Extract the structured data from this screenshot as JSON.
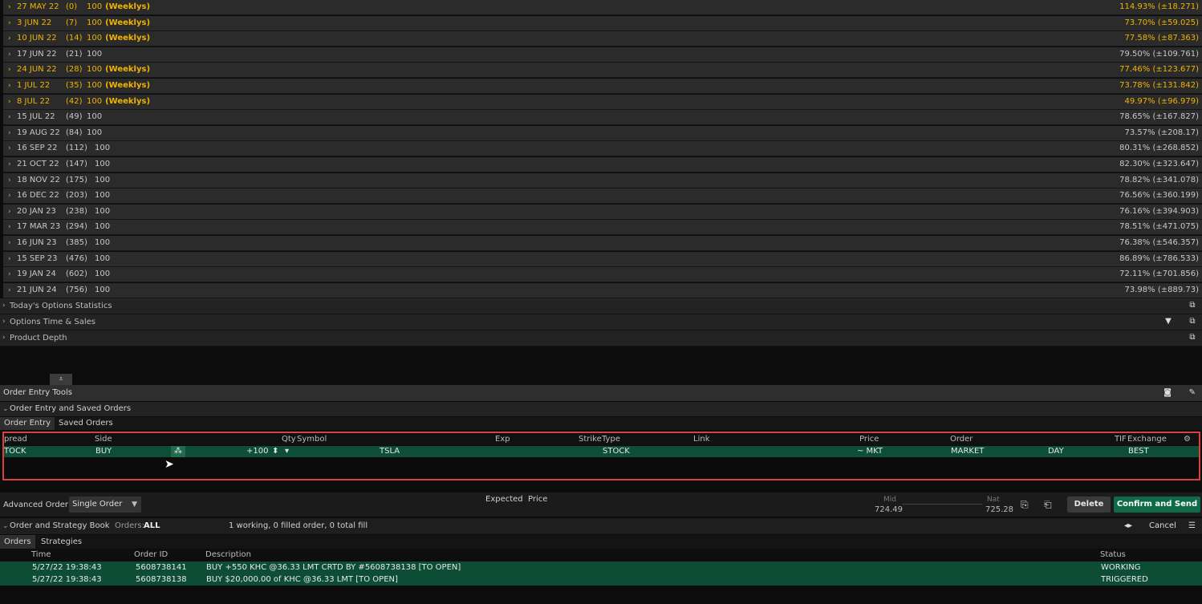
{
  "chain": {
    "rows": [
      {
        "date": "27 MAY 22",
        "days": "(0)",
        "mult": "100",
        "weekly": "(Weeklys)",
        "iv": "114.93% (±18.271)"
      },
      {
        "date": "3 JUN 22",
        "days": "(7)",
        "mult": "100",
        "weekly": "(Weeklys)",
        "iv": "73.70% (±59.025)"
      },
      {
        "date": "10 JUN 22",
        "days": "(14)",
        "mult": "100",
        "weekly": "(Weeklys)",
        "iv": "77.58% (±87.363)"
      },
      {
        "date": "17 JUN 22",
        "days": "(21)",
        "mult": "100",
        "weekly": "",
        "iv": "79.50% (±109.761)"
      },
      {
        "date": "24 JUN 22",
        "days": "(28)",
        "mult": "100",
        "weekly": "(Weeklys)",
        "iv": "77.46% (±123.677)"
      },
      {
        "date": "1 JUL 22",
        "days": "(35)",
        "mult": "100",
        "weekly": "(Weeklys)",
        "iv": "73.78% (±131.842)"
      },
      {
        "date": "8 JUL 22",
        "days": "(42)",
        "mult": "100",
        "weekly": "(Weeklys)",
        "iv": "49.97% (±96.979)"
      },
      {
        "date": "15 JUL 22",
        "days": "(49)",
        "mult": "100",
        "weekly": "",
        "iv": "78.65% (±167.827)"
      },
      {
        "date": "19 AUG 22",
        "days": "(84)",
        "mult": "100",
        "weekly": "",
        "iv": "73.57% (±208.17)"
      },
      {
        "date": "16 SEP 22",
        "days": "(112)",
        "mult": "100",
        "weekly": "",
        "iv": "80.31% (±268.852)"
      },
      {
        "date": "21 OCT 22",
        "days": "(147)",
        "mult": "100",
        "weekly": "",
        "iv": "82.30% (±323.647)"
      },
      {
        "date": "18 NOV 22",
        "days": "(175)",
        "mult": "100",
        "weekly": "",
        "iv": "78.82% (±341.078)"
      },
      {
        "date": "16 DEC 22",
        "days": "(203)",
        "mult": "100",
        "weekly": "",
        "iv": "76.56% (±360.199)"
      },
      {
        "date": "20 JAN 23",
        "days": "(238)",
        "mult": "100",
        "weekly": "",
        "iv": "76.16% (±394.903)"
      },
      {
        "date": "17 MAR 23",
        "days": "(294)",
        "mult": "100",
        "weekly": "",
        "iv": "78.51% (±471.075)"
      },
      {
        "date": "16 JUN 23",
        "days": "(385)",
        "mult": "100",
        "weekly": "",
        "iv": "76.38% (±546.357)"
      },
      {
        "date": "15 SEP 23",
        "days": "(476)",
        "mult": "100",
        "weekly": "",
        "iv": "86.89% (±786.533)"
      },
      {
        "date": "19 JAN 24",
        "days": "(602)",
        "mult": "100",
        "weekly": "",
        "iv": "72.11% (±701.856)"
      },
      {
        "date": "21 JUN 24",
        "days": "(756)",
        "mult": "100",
        "weekly": "",
        "iv": "73.98% (±889.73)"
      }
    ],
    "sections": [
      "Today's Options Statistics",
      "Options Time & Sales",
      "Product Depth"
    ]
  },
  "order_entry": {
    "panel_title": "Order Entry Tools",
    "section_title": "Order Entry and Saved Orders",
    "tabs": [
      "Order Entry",
      "Saved Orders"
    ],
    "headers": {
      "spread": "pread",
      "side": "Side",
      "qty": "Qty",
      "symbol": "Symbol",
      "exp": "Exp",
      "strike": "Strike",
      "type": "Type",
      "link": "Link",
      "price": "Price",
      "order": "Order",
      "tif": "TIF",
      "exchange": "Exchange"
    },
    "row": {
      "spread": "TOCK",
      "side": "BUY",
      "qty": "+100",
      "symbol": "TSLA",
      "type": "STOCK",
      "price": "~ MKT",
      "order": "MARKET",
      "tif": "DAY",
      "exchange": "BEST"
    }
  },
  "toolbar": {
    "advanced_label": "Advanced Order:",
    "advanced_value": "Single Order",
    "expected_price": "Expected  Price",
    "mid_label": "Mid",
    "mid_value": "724.49",
    "nat_label": "Nat",
    "nat_value": "725.28",
    "delete": "Delete",
    "confirm": "Confirm and Send"
  },
  "book": {
    "title": "Order and Strategy Book",
    "orders_label": "Orders:",
    "orders_value": "ALL",
    "summary": "1 working, 0 filled order, 0 total fill",
    "cancel": "Cancel",
    "tabs": [
      "Orders",
      "Strategies"
    ],
    "headers": {
      "time": "Time",
      "order_id": "Order ID",
      "description": "Description",
      "status": "Status"
    },
    "rows": [
      {
        "time": "5/27/22 19:38:43",
        "order_id": "5608738141",
        "description": "BUY +550 KHC @36.33 LMT CRTD BY #5608738138 [TO OPEN]",
        "status": "WORKING"
      },
      {
        "time": "5/27/22 19:38:43",
        "order_id": "5608738138",
        "description": "BUY $20,000.00 of KHC @36.33 LMT [TO OPEN]",
        "status": "TRIGGERED"
      }
    ]
  }
}
